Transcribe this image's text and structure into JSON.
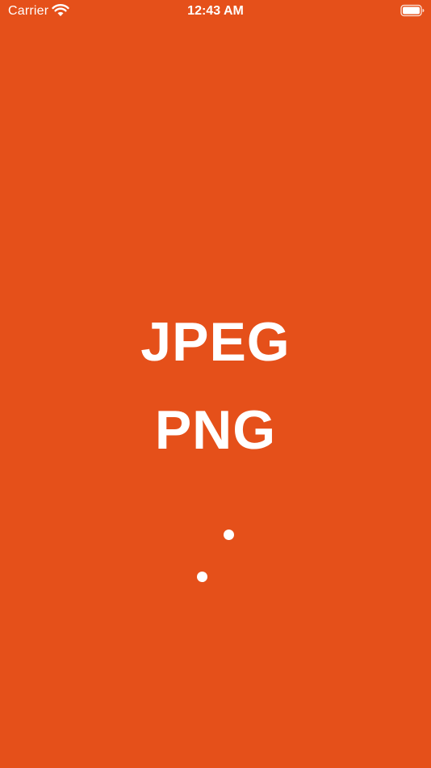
{
  "status_bar": {
    "carrier": "Carrier",
    "time": "12:43 AM",
    "wifi_icon": "wifi-icon",
    "battery_icon": "battery-icon"
  },
  "splash": {
    "line1": "JPEG",
    "line2": "PNG",
    "background_color": "#E5501A",
    "text_color": "#FFFFFF",
    "loading_indicator": "dots-spinner"
  }
}
